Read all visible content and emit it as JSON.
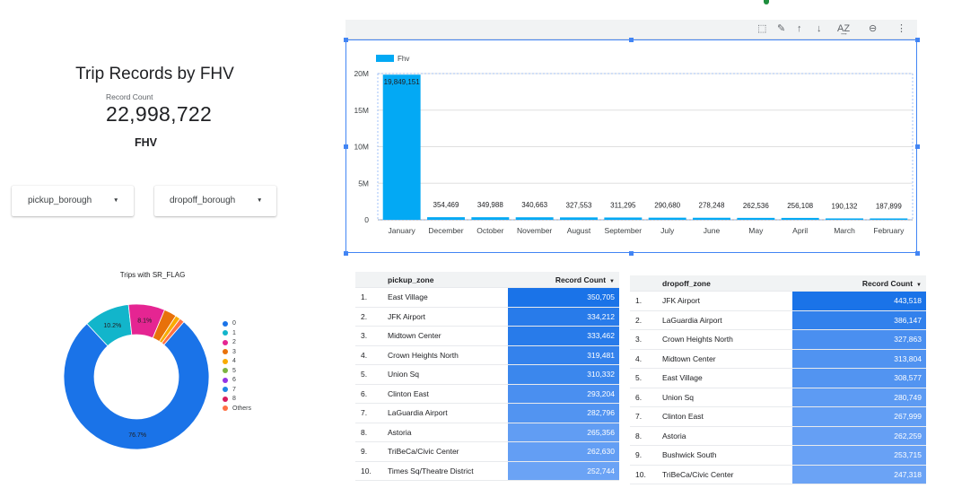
{
  "scorecard": {
    "title": "Trip Records by FHV",
    "record_count_label": "Record Count",
    "record_count_value": "22,998,722",
    "fhv_label": "FHV"
  },
  "filters": {
    "pickup_label": "pickup_borough",
    "dropoff_label": "dropoff_borough"
  },
  "donut": {
    "title": "Trips with SR_FLAG",
    "slices": [
      {
        "label": "0",
        "value": 76.7,
        "color": "#1a73e8",
        "text": "76.7%"
      },
      {
        "label": "1",
        "value": 10.2,
        "color": "#12b5cb",
        "text": "10.2%"
      },
      {
        "label": "2",
        "value": 8.1,
        "color": "#e52592",
        "text": "8.1%"
      },
      {
        "label": "3",
        "value": 2.8,
        "color": "#e8710a",
        "text": ""
      },
      {
        "label": "4",
        "value": 1.1,
        "color": "#f9ab00",
        "text": ""
      },
      {
        "label": "5",
        "value": 0.0,
        "color": "#7cb342",
        "text": ""
      },
      {
        "label": "6",
        "value": 0.0,
        "color": "#9334e6",
        "text": ""
      },
      {
        "label": "7",
        "value": 0.0,
        "color": "#1e88e5",
        "text": ""
      },
      {
        "label": "8",
        "value": 0.0,
        "color": "#d81b60",
        "text": ""
      },
      {
        "label": "Others",
        "value": 1.1,
        "color": "#ff7043",
        "text": ""
      }
    ]
  },
  "chart_data": {
    "type": "bar",
    "legend": "Fhv",
    "legend_color": "#03a9f4",
    "categories": [
      "January",
      "December",
      "October",
      "November",
      "August",
      "September",
      "July",
      "June",
      "May",
      "April",
      "March",
      "February"
    ],
    "values": [
      19849151,
      354469,
      349988,
      340663,
      327553,
      311295,
      290680,
      278248,
      262536,
      256108,
      190132,
      187899
    ],
    "value_labels": [
      "19,849,151",
      "354,469",
      "349,988",
      "340,663",
      "327,553",
      "311,295",
      "290,680",
      "278,248",
      "262,536",
      "256,108",
      "190,132",
      "187,899"
    ],
    "y_ticks": [
      "0",
      "5M",
      "10M",
      "15M",
      "20M"
    ],
    "ylim": [
      0,
      20000000
    ],
    "grid": true,
    "legend_position": "top-left"
  },
  "toolbar": {
    "icons": [
      "select-icon",
      "edit-icon",
      "sort-up-icon",
      "sort-down-icon",
      "sort-az-icon",
      "zoom-icon",
      "more-icon"
    ],
    "glyphs": [
      "⬚",
      "✎",
      "↑",
      "↓",
      "A͢Z",
      "⊖",
      "⋮"
    ]
  },
  "pickup_table": {
    "col_zone": "pickup_zone",
    "col_count": "Record Count",
    "rows": [
      {
        "n": "1.",
        "zone": "East Village",
        "count": "350,705",
        "v": 350705
      },
      {
        "n": "2.",
        "zone": "JFK Airport",
        "count": "334,212",
        "v": 334212
      },
      {
        "n": "3.",
        "zone": "Midtown Center",
        "count": "333,462",
        "v": 333462
      },
      {
        "n": "4.",
        "zone": "Crown Heights North",
        "count": "319,481",
        "v": 319481
      },
      {
        "n": "5.",
        "zone": "Union Sq",
        "count": "310,332",
        "v": 310332
      },
      {
        "n": "6.",
        "zone": "Clinton East",
        "count": "293,204",
        "v": 293204
      },
      {
        "n": "7.",
        "zone": "LaGuardia Airport",
        "count": "282,796",
        "v": 282796
      },
      {
        "n": "8.",
        "zone": "Astoria",
        "count": "265,356",
        "v": 265356
      },
      {
        "n": "9.",
        "zone": "TriBeCa/Civic Center",
        "count": "262,630",
        "v": 262630
      },
      {
        "n": "10.",
        "zone": "Times Sq/Theatre District",
        "count": "252,744",
        "v": 252744
      }
    ]
  },
  "dropoff_table": {
    "col_zone": "dropoff_zone",
    "col_count": "Record Count",
    "rows": [
      {
        "n": "1.",
        "zone": "JFK Airport",
        "count": "443,518",
        "v": 443518
      },
      {
        "n": "2.",
        "zone": "LaGuardia Airport",
        "count": "386,147",
        "v": 386147
      },
      {
        "n": "3.",
        "zone": "Crown Heights North",
        "count": "327,863",
        "v": 327863
      },
      {
        "n": "4.",
        "zone": "Midtown Center",
        "count": "313,804",
        "v": 313804
      },
      {
        "n": "5.",
        "zone": "East Village",
        "count": "308,577",
        "v": 308577
      },
      {
        "n": "6.",
        "zone": "Union Sq",
        "count": "280,749",
        "v": 280749
      },
      {
        "n": "7.",
        "zone": "Clinton East",
        "count": "267,999",
        "v": 267999
      },
      {
        "n": "8.",
        "zone": "Astoria",
        "count": "262,259",
        "v": 262259
      },
      {
        "n": "9.",
        "zone": "Bushwick South",
        "count": "253,715",
        "v": 253715
      },
      {
        "n": "10.",
        "zone": "TriBeCa/Civic Center",
        "count": "247,318",
        "v": 247318
      }
    ]
  }
}
